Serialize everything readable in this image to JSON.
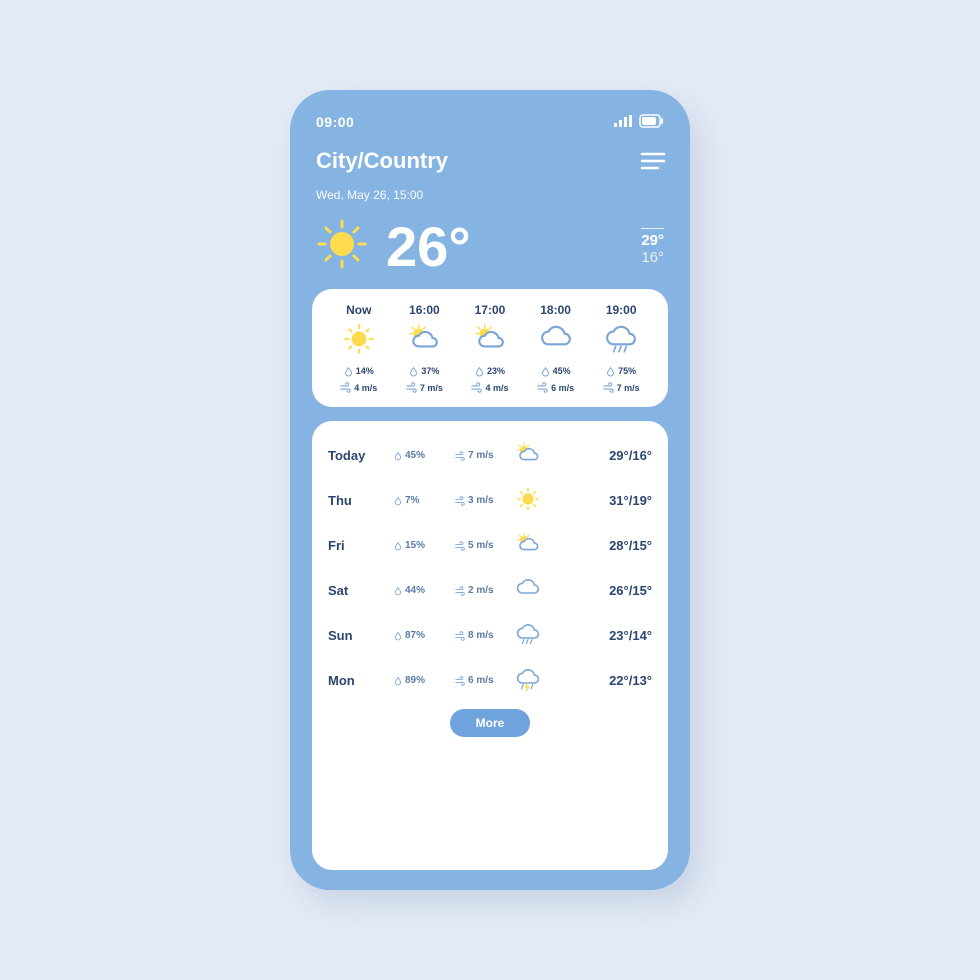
{
  "colors": {
    "accent": "#86b4e2",
    "sun": "#ffdb4d",
    "outline": "#7aa5d6",
    "text": "#2b466f"
  },
  "status": {
    "time": "09:00"
  },
  "header": {
    "title": "City/Country"
  },
  "date": "Wed, May 26, 15:00",
  "current": {
    "temp": "26°",
    "hi": "29°",
    "lo": "16°",
    "icon": "sun"
  },
  "hourly": [
    {
      "time": "Now",
      "icon": "sun",
      "precip": "14%",
      "wind": "4 m/s"
    },
    {
      "time": "16:00",
      "icon": "sun-cloud",
      "precip": "37%",
      "wind": "7 m/s"
    },
    {
      "time": "17:00",
      "icon": "sun-cloud",
      "precip": "23%",
      "wind": "4 m/s"
    },
    {
      "time": "18:00",
      "icon": "cloud",
      "precip": "45%",
      "wind": "6 m/s"
    },
    {
      "time": "19:00",
      "icon": "rain",
      "precip": "75%",
      "wind": "7 m/s"
    }
  ],
  "daily": [
    {
      "name": "Today",
      "precip": "45%",
      "wind": "7 m/s",
      "icon": "sun-cloud",
      "range": "29°/16°"
    },
    {
      "name": "Thu",
      "precip": "7%",
      "wind": "3 m/s",
      "icon": "sun",
      "range": "31°/19°"
    },
    {
      "name": "Fri",
      "precip": "15%",
      "wind": "5 m/s",
      "icon": "sun-cloud",
      "range": "28°/15°"
    },
    {
      "name": "Sat",
      "precip": "44%",
      "wind": "2 m/s",
      "icon": "cloud",
      "range": "26°/15°"
    },
    {
      "name": "Sun",
      "precip": "87%",
      "wind": "8 m/s",
      "icon": "rain",
      "range": "23°/14°"
    },
    {
      "name": "Mon",
      "precip": "89%",
      "wind": "6 m/s",
      "icon": "storm",
      "range": "22°/13°"
    }
  ],
  "more_label": "More"
}
